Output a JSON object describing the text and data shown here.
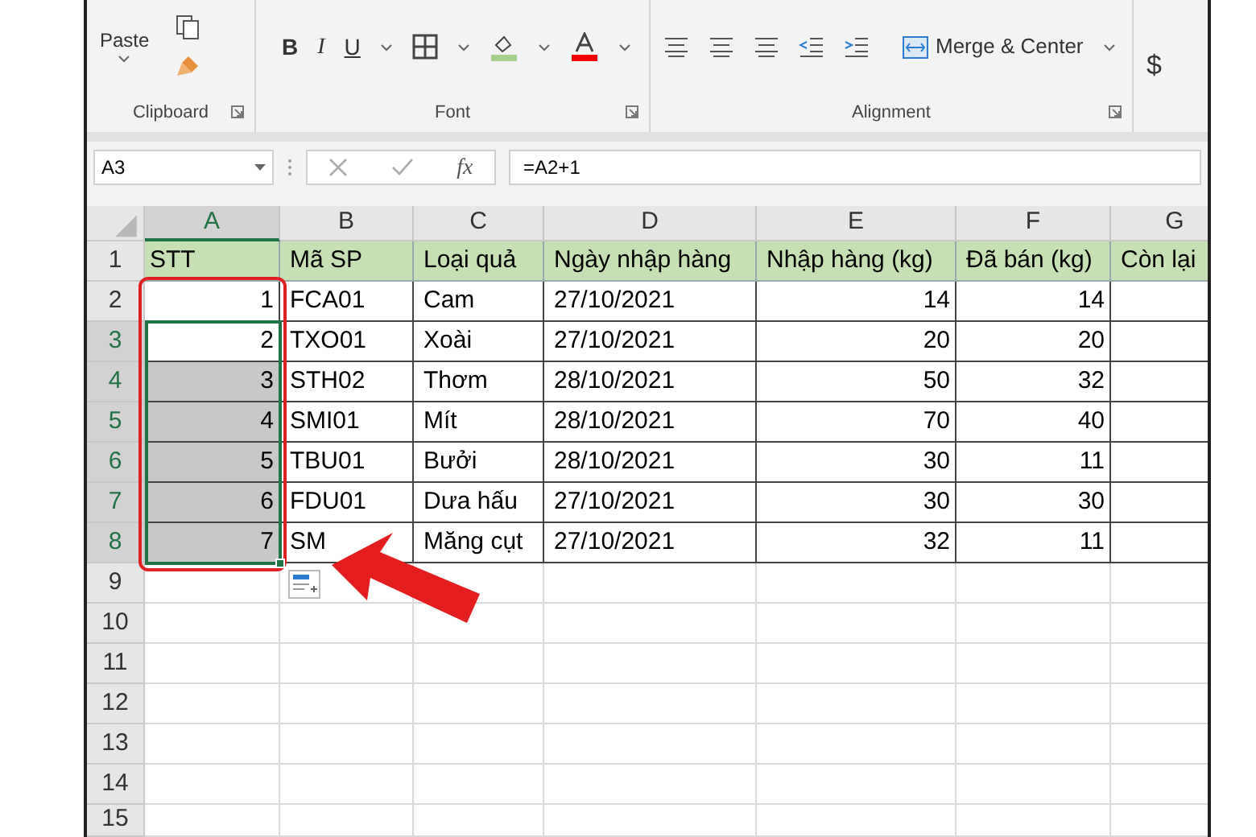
{
  "ribbon": {
    "groups": [
      {
        "kind": "clipboard",
        "label": "Clipboard",
        "paste": "Paste"
      },
      {
        "kind": "font",
        "label": "Font",
        "bold": "B",
        "italic": "I",
        "underline": "U"
      },
      {
        "kind": "alignment",
        "label": "Alignment",
        "merge": "Merge & Center"
      },
      {
        "kind": "number",
        "currency": "$"
      }
    ]
  },
  "formula_bar": {
    "name_box": "A3",
    "fx": "fx",
    "formula": "=A2+1"
  },
  "sheet": {
    "columns": [
      {
        "letter": "A",
        "selected": true,
        "kind": "number"
      },
      {
        "letter": "B",
        "selected": false,
        "kind": "text"
      },
      {
        "letter": "C",
        "selected": false,
        "kind": "text"
      },
      {
        "letter": "D",
        "selected": false,
        "kind": "text"
      },
      {
        "letter": "E",
        "selected": false,
        "kind": "number"
      },
      {
        "letter": "F",
        "selected": false,
        "kind": "number"
      },
      {
        "letter": "G",
        "selected": false,
        "kind": "text"
      }
    ],
    "rows": [
      {
        "number": "1",
        "kind": "header",
        "selected": false,
        "shaded": false,
        "cells": [
          "STT",
          "Mã SP",
          "Loại quả",
          "Ngày nhập hàng",
          "Nhập hàng (kg)",
          "Đã bán (kg)",
          "Còn lại"
        ]
      },
      {
        "number": "2",
        "kind": "data",
        "selected": false,
        "shaded": false,
        "cells": [
          "1",
          "FCA01",
          "Cam",
          "27/10/2021",
          "14",
          "14"
        ]
      },
      {
        "number": "3",
        "kind": "data",
        "selected": true,
        "shaded": false,
        "cells": [
          "2",
          "TXO01",
          "Xoài",
          "27/10/2021",
          "20",
          "20"
        ]
      },
      {
        "number": "4",
        "kind": "data",
        "selected": true,
        "shaded": true,
        "cells": [
          "3",
          "STH02",
          "Thơm",
          "28/10/2021",
          "50",
          "32"
        ]
      },
      {
        "number": "5",
        "kind": "data",
        "selected": true,
        "shaded": true,
        "cells": [
          "4",
          "SMI01",
          "Mít",
          "28/10/2021",
          "70",
          "40"
        ]
      },
      {
        "number": "6",
        "kind": "data",
        "selected": true,
        "shaded": true,
        "cells": [
          "5",
          "TBU01",
          "Bưởi",
          "28/10/2021",
          "30",
          "11"
        ]
      },
      {
        "number": "7",
        "kind": "data",
        "selected": true,
        "shaded": true,
        "cells": [
          "6",
          "FDU01",
          "Dưa hấu",
          "27/10/2021",
          "30",
          "30"
        ]
      },
      {
        "number": "8",
        "kind": "data",
        "selected": true,
        "shaded": true,
        "cells": [
          "7",
          "SM",
          "Măng cụt",
          "27/10/2021",
          "32",
          "11"
        ]
      },
      {
        "number": "9",
        "kind": "data",
        "selected": false,
        "shaded": false
      },
      {
        "number": "10",
        "kind": "data",
        "selected": false,
        "shaded": false
      },
      {
        "number": "11",
        "kind": "data",
        "selected": false,
        "shaded": false
      },
      {
        "number": "12",
        "kind": "data",
        "selected": false,
        "shaded": false
      },
      {
        "number": "13",
        "kind": "data",
        "selected": false,
        "shaded": false
      },
      {
        "number": "14",
        "kind": "data",
        "selected": false,
        "shaded": false
      },
      {
        "number": "15",
        "kind": "data",
        "selected": false,
        "shaded": false
      }
    ]
  }
}
